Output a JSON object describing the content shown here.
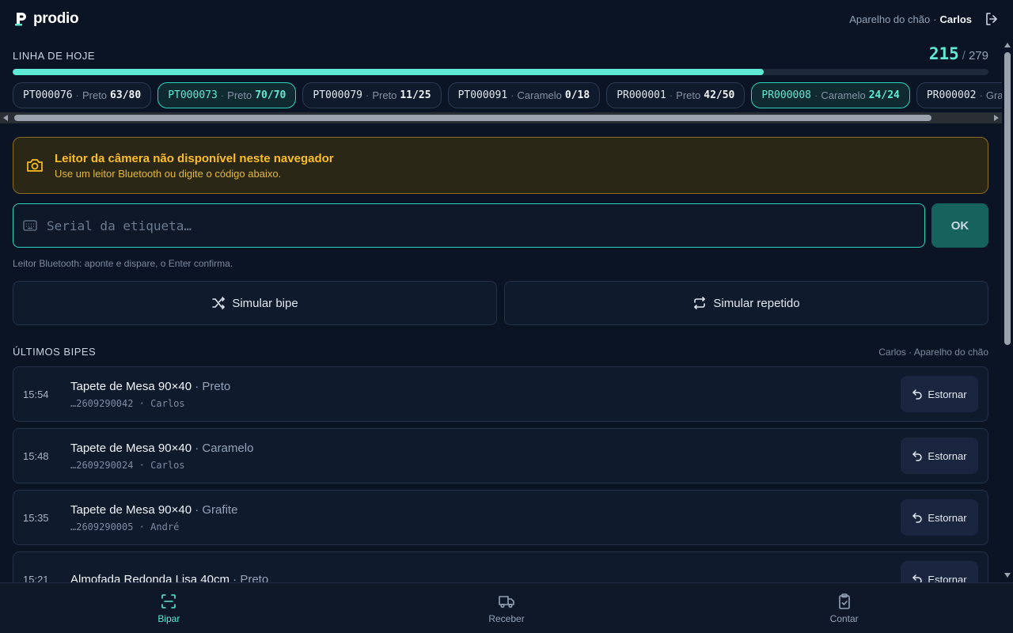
{
  "app": {
    "name": "prodio"
  },
  "header": {
    "device": "Aparelho do chão",
    "separator": "·",
    "user": "Carlos"
  },
  "today": {
    "label": "LINHA DE HOJE",
    "done": "215",
    "slash": "/",
    "total": "279",
    "progress_fraction": 0.77,
    "chips": [
      {
        "code": "PT000076",
        "color": "Preto",
        "qty": "63/80",
        "done": false
      },
      {
        "code": "PT000073",
        "color": "Preto",
        "qty": "70/70",
        "done": true
      },
      {
        "code": "PT000079",
        "color": "Preto",
        "qty": "11/25",
        "done": false
      },
      {
        "code": "PT000091",
        "color": "Caramelo",
        "qty": "0/18",
        "done": false
      },
      {
        "code": "PR000001",
        "color": "Preto",
        "qty": "42/50",
        "done": false
      },
      {
        "code": "PR000008",
        "color": "Caramelo",
        "qty": "24/24",
        "done": true
      },
      {
        "code": "PR000002",
        "color": "Grafite",
        "qty": "",
        "done": false
      }
    ]
  },
  "warning": {
    "title": "Leitor da câmera não disponível neste navegador",
    "subtitle": "Use um leitor Bluetooth ou digite o código abaixo."
  },
  "serial": {
    "placeholder": "Serial da etiqueta…",
    "value": "",
    "ok_label": "OK"
  },
  "hint": "Leitor Bluetooth: aponte e dispare, o Enter confirma.",
  "actions": {
    "simulate_scan": "Simular bipe",
    "simulate_repeat": "Simular repetido"
  },
  "last": {
    "title": "ÚLTIMOS BIPES",
    "meta": "Carlos · Aparelho do chão",
    "undo_label": "Estornar",
    "items": [
      {
        "time": "15:54",
        "product": "Tapete de Mesa 90×40",
        "variant": "Preto",
        "serial": "…2609290042",
        "user": "Carlos"
      },
      {
        "time": "15:48",
        "product": "Tapete de Mesa 90×40",
        "variant": "Caramelo",
        "serial": "…2609290024",
        "user": "Carlos"
      },
      {
        "time": "15:35",
        "product": "Tapete de Mesa 90×40",
        "variant": "Grafite",
        "serial": "…2609290005",
        "user": "André"
      },
      {
        "time": "15:21",
        "product": "Almofada Redonda Lisa 40cm",
        "variant": "Preto",
        "serial": "",
        "user": ""
      }
    ]
  },
  "nav": [
    {
      "label": "Bipar",
      "icon": "scan-icon",
      "active": true
    },
    {
      "label": "Receber",
      "icon": "truck-icon",
      "active": false
    },
    {
      "label": "Contar",
      "icon": "clipboard-check-icon",
      "active": false
    }
  ],
  "colors": {
    "accent": "#5eead4",
    "warning": "#fbbf24",
    "background": "#0b1424"
  }
}
